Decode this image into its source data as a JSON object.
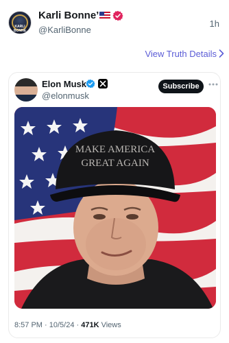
{
  "post": {
    "author_name": "Karli Bonne’",
    "author_handle": "@KarliBonne",
    "age": "1h",
    "avatar_text": "KARLI BONNE",
    "view_details_label": "View Truth Details"
  },
  "embed": {
    "name": "Elon Musk",
    "handle": "@elonmusk",
    "subscribe_label": "Subscribe",
    "hat_text_line1": "MAKE AMERICA",
    "hat_text_line2": "GREAT AGAIN",
    "time": "8:57 PM",
    "date": "10/5/24",
    "views_count": "471K",
    "views_label": "Views",
    "separator": " · "
  },
  "colors": {
    "link": "#5b5cd6",
    "verified_badge": "#e0245e",
    "x_verified": "#1d9bf0",
    "subscribe_bg": "#0f1419"
  },
  "icons": [
    "us-flag-icon",
    "verified-badge-icon",
    "chevron-right-icon",
    "x-verified-icon",
    "x-logo-icon",
    "more-icon"
  ]
}
